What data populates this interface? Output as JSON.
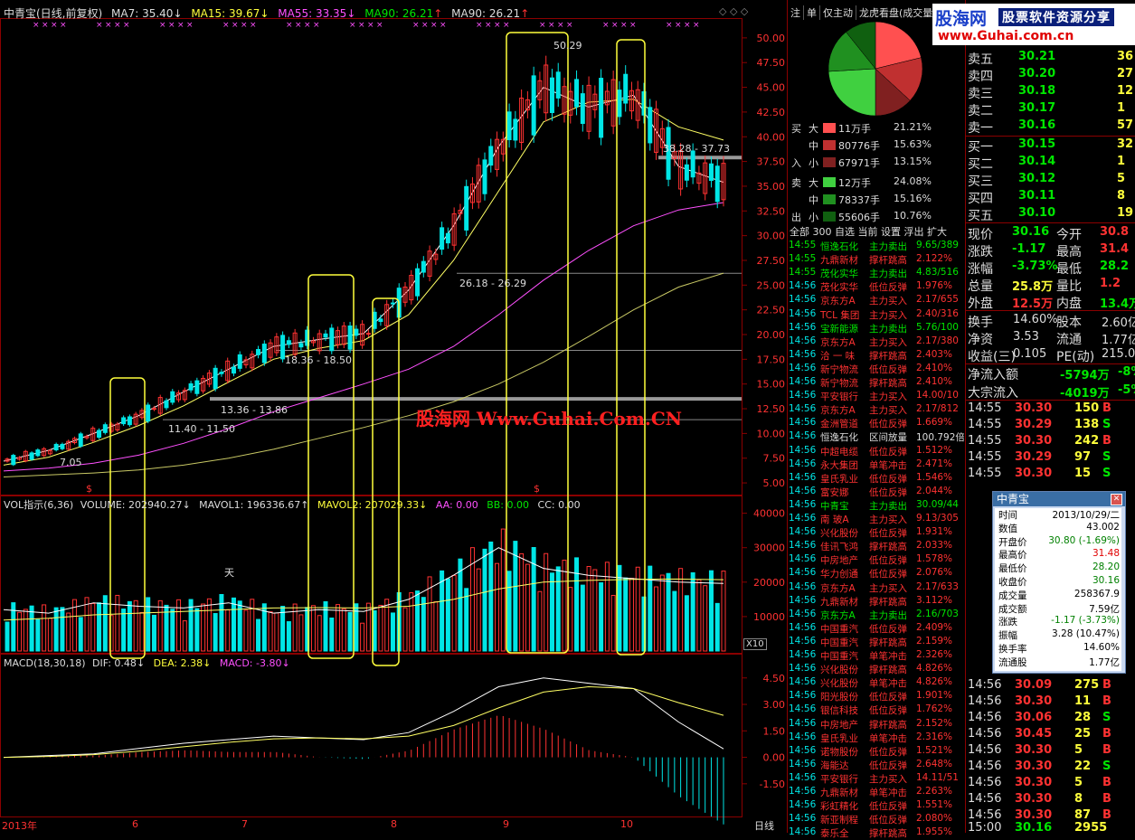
{
  "header": {
    "title": "中青宝(日线,前复权)",
    "ma7": "MA7: 35.40",
    "ma15": "MA15: 39.67",
    "ma55": "MA55: 33.35",
    "ma90a": "MA90: 26.21",
    "ma90b": "MA90: 26.21"
  },
  "vol_header": {
    "name": "VOL指示(6,36)",
    "volume": "VOLUME: 202940.27",
    "mavol1": "MAVOL1: 196336.67",
    "mavol2": "MAVOL2: 207029.33",
    "aa": "AA: 0.00",
    "bb": "BB: 0.00",
    "cc": "CC: 0.00"
  },
  "macd_header": {
    "name": "MACD(18,30,18)",
    "dif": "DIF: 0.48",
    "dea": "DEA: 2.38",
    "macd": "MACD: -3.80"
  },
  "bottom_axis": {
    "labels": [
      "2013年",
      "6",
      "7",
      "8",
      "9",
      "10"
    ],
    "period": "日线"
  },
  "x10_label": "X10",
  "chart_annotations": {
    "peak1": "50.29",
    "range1": "38.28 - 37.73",
    "range2": "26.18 - 26.29",
    "range3": "18.36 - 18.50",
    "range4": "13.36 - 13.86",
    "range5": "11.40 - 11.50",
    "low": "7.05",
    "tian": "天",
    "dollar": "$"
  },
  "watermark": "股海网 Www.Guhai.Com.CN",
  "chart_data": [
    {
      "type": "line",
      "title": "中青宝(日线,前复权)",
      "xlabel": "",
      "ylabel": "",
      "y_ticks": [
        5.0,
        7.5,
        10.0,
        12.5,
        15.0,
        17.5,
        20.0,
        22.5,
        25.0,
        27.5,
        30.0,
        32.5,
        35.0,
        37.5,
        40.0,
        42.5,
        45.0,
        47.5,
        50.0
      ],
      "ylim": [
        4.0,
        52.0
      ],
      "x_labels": [
        "2013年",
        "6",
        "7",
        "8",
        "9",
        "10"
      ],
      "series": [
        {
          "name": "MA7",
          "values": [
            7.2,
            8.3,
            10.0,
            11.8,
            14.2,
            16.5,
            18.8,
            19.5,
            20.1,
            24.5,
            31.0,
            39.0,
            45.0,
            43.0,
            44.2,
            37.0,
            35.4
          ]
        },
        {
          "name": "MA15",
          "values": [
            6.8,
            7.6,
            9.1,
            10.8,
            12.8,
            15.2,
            17.5,
            18.6,
            19.4,
            22.0,
            27.5,
            34.5,
            41.5,
            43.5,
            43.8,
            41.0,
            39.67
          ]
        },
        {
          "name": "MA55",
          "values": [
            6.2,
            6.5,
            7.0,
            7.8,
            9.0,
            10.5,
            12.2,
            13.6,
            15.0,
            16.5,
            18.8,
            22.0,
            25.5,
            28.5,
            31.0,
            32.6,
            33.35
          ]
        },
        {
          "name": "MA90",
          "values": [
            5.6,
            5.8,
            6.0,
            6.3,
            6.8,
            7.5,
            8.4,
            9.5,
            10.6,
            11.8,
            13.2,
            15.0,
            17.2,
            19.8,
            22.5,
            24.8,
            26.21
          ]
        }
      ]
    },
    {
      "type": "bar",
      "title": "VOL指示(6,36)",
      "y_ticks": [
        10000,
        20000,
        30000,
        40000
      ],
      "ylim": [
        0,
        42000
      ],
      "series": [
        {
          "name": "MAVOL1",
          "values": [
            12000,
            11000,
            14000,
            13000,
            12500,
            14000,
            11000,
            12000,
            11500,
            15000,
            22000,
            30000,
            24000,
            22000,
            21000,
            20000,
            19634
          ]
        },
        {
          "name": "MAVOL2",
          "values": [
            9000,
            9500,
            10500,
            11000,
            11500,
            12000,
            12500,
            12600,
            12500,
            13000,
            15000,
            18000,
            20000,
            20500,
            20800,
            20900,
            20703
          ]
        }
      ]
    },
    {
      "type": "line",
      "title": "MACD(18,30,18)",
      "y_ticks": [
        -1.5,
        0.0,
        1.5,
        3.0,
        4.5
      ],
      "ylim": [
        -3.2,
        5.0
      ],
      "series": [
        {
          "name": "DIF",
          "values": [
            0.0,
            0.1,
            0.2,
            0.5,
            0.8,
            1.0,
            1.2,
            1.1,
            1.0,
            1.4,
            2.6,
            4.0,
            4.5,
            4.2,
            3.9,
            2.0,
            0.48
          ]
        },
        {
          "name": "DEA",
          "values": [
            0.0,
            0.05,
            0.15,
            0.35,
            0.6,
            0.85,
            1.05,
            1.1,
            1.05,
            1.2,
            1.8,
            2.8,
            3.7,
            4.0,
            3.9,
            3.1,
            2.38
          ]
        }
      ]
    },
    {
      "type": "pie",
      "categories": [
        "买大",
        "买中",
        "买小",
        "卖大",
        "卖中",
        "卖小"
      ],
      "values": [
        21.21,
        15.63,
        13.15,
        24.08,
        15.16,
        10.76
      ]
    }
  ],
  "right_panel": {
    "tabs": [
      "注",
      "单",
      "仅主动",
      "龙虎看盘(成交量"
    ],
    "flow": [
      {
        "side": "买",
        "size": "大",
        "amount": "11万手",
        "pct": "21.21%",
        "color": "#ff5050"
      },
      {
        "side": "",
        "size": "中",
        "amount": "80776手",
        "pct": "15.63%",
        "color": "#c03030"
      },
      {
        "side": "入",
        "size": "小",
        "amount": "67971手",
        "pct": "13.15%",
        "color": "#802020"
      },
      {
        "side": "卖",
        "size": "大",
        "amount": "12万手",
        "pct": "24.08%",
        "color": "#40d040"
      },
      {
        "side": "",
        "size": "中",
        "amount": "78337手",
        "pct": "15.16%",
        "color": "#209020"
      },
      {
        "side": "出",
        "size": "小",
        "amount": "55606手",
        "pct": "10.76%",
        "color": "#106010"
      }
    ],
    "list_tabs": [
      "全部",
      "300",
      "自选",
      "当前",
      "设置",
      "浮出",
      "扩大"
    ],
    "alerts": [
      {
        "time": "14:55",
        "name": "恒逸石化",
        "type": "主力卖出",
        "val": "9.65/389",
        "c": "green"
      },
      {
        "time": "14:55",
        "name": "九鼎新材",
        "type": "撑杆跳高",
        "val": "2.122%",
        "c": "red"
      },
      {
        "time": "14:55",
        "name": "茂化实华",
        "type": "主力卖出",
        "val": "4.83/516",
        "c": "green"
      },
      {
        "time": "14:56",
        "name": "茂化实华",
        "type": "低位反弹",
        "val": "1.976%",
        "c": "red"
      },
      {
        "time": "14:56",
        "name": "京东方A",
        "type": "主力买入",
        "val": "2.17/655",
        "c": "red"
      },
      {
        "time": "14:56",
        "name": "TCL 集团",
        "type": "主力买入",
        "val": "2.40/316",
        "c": "red"
      },
      {
        "time": "14:56",
        "name": "宝新能源",
        "type": "主力卖出",
        "val": "5.76/100",
        "c": "green"
      },
      {
        "time": "14:56",
        "name": "京东方A",
        "type": "主力买入",
        "val": "2.17/380",
        "c": "red"
      },
      {
        "time": "14:56",
        "name": "洽 一 味",
        "type": "撑杆跳高",
        "val": "2.403%",
        "c": "red"
      },
      {
        "time": "14:56",
        "name": "新宁物流",
        "type": "低位反弹",
        "val": "2.410%",
        "c": "red"
      },
      {
        "time": "14:56",
        "name": "新宁物流",
        "type": "撑杆跳高",
        "val": "2.410%",
        "c": "red"
      },
      {
        "time": "14:56",
        "name": "平安银行",
        "type": "主力买入",
        "val": "14.00/10",
        "c": "red"
      },
      {
        "time": "14:56",
        "name": "京东方A",
        "type": "主力买入",
        "val": "2.17/812",
        "c": "red"
      },
      {
        "time": "14:56",
        "name": "金洲管道",
        "type": "低位反弹",
        "val": "1.669%",
        "c": "red"
      },
      {
        "time": "14:56",
        "name": "恒逸石化",
        "type": "区间放量",
        "val": "100.792倍",
        "c": "white"
      },
      {
        "time": "14:56",
        "name": "中超电缆",
        "type": "低位反弹",
        "val": "1.512%",
        "c": "red"
      },
      {
        "time": "14:56",
        "name": "永大集团",
        "type": "单笔冲击",
        "val": "2.471%",
        "c": "red"
      },
      {
        "time": "14:56",
        "name": "皇氏乳业",
        "type": "低位反弹",
        "val": "1.546%",
        "c": "red"
      },
      {
        "time": "14:56",
        "name": "富安娜",
        "type": "低位反弹",
        "val": "2.044%",
        "c": "red"
      },
      {
        "time": "14:56",
        "name": "中青宝",
        "type": "主力卖出",
        "val": "30.09/44",
        "c": "green"
      },
      {
        "time": "14:56",
        "name": "南 玻A",
        "type": "主力买入",
        "val": "9.13/305",
        "c": "red"
      },
      {
        "time": "14:56",
        "name": "兴化股份",
        "type": "低位反弹",
        "val": "1.931%",
        "c": "red"
      },
      {
        "time": "14:56",
        "name": "佳讯飞鸿",
        "type": "撑杆跳高",
        "val": "2.033%",
        "c": "red"
      },
      {
        "time": "14:56",
        "name": "中房地产",
        "type": "低位反弹",
        "val": "1.578%",
        "c": "red"
      },
      {
        "time": "14:56",
        "name": "华力创通",
        "type": "低位反弹",
        "val": "2.076%",
        "c": "red"
      },
      {
        "time": "14:56",
        "name": "京东方A",
        "type": "主力买入",
        "val": "2.17/633",
        "c": "red"
      },
      {
        "time": "14:56",
        "name": "九鼎新材",
        "type": "撑杆跳高",
        "val": "3.112%",
        "c": "red"
      },
      {
        "time": "14:56",
        "name": "京东方A",
        "type": "主力卖出",
        "val": "2.16/703",
        "c": "green"
      },
      {
        "time": "14:56",
        "name": "中国重汽",
        "type": "低位反弹",
        "val": "2.409%",
        "c": "red"
      },
      {
        "time": "14:56",
        "name": "中国重汽",
        "type": "撑杆跳高",
        "val": "2.159%",
        "c": "red"
      },
      {
        "time": "14:56",
        "name": "中国重汽",
        "type": "单笔冲击",
        "val": "2.326%",
        "c": "red"
      },
      {
        "time": "14:56",
        "name": "兴化股份",
        "type": "撑杆跳高",
        "val": "4.826%",
        "c": "red"
      },
      {
        "time": "14:56",
        "name": "兴化股份",
        "type": "单笔冲击",
        "val": "4.826%",
        "c": "red"
      },
      {
        "time": "14:56",
        "name": "阳光股份",
        "type": "低位反弹",
        "val": "1.901%",
        "c": "red"
      },
      {
        "time": "14:56",
        "name": "银信科技",
        "type": "低位反弹",
        "val": "1.762%",
        "c": "red"
      },
      {
        "time": "14:56",
        "name": "中房地产",
        "type": "撑杆跳高",
        "val": "2.152%",
        "c": "red"
      },
      {
        "time": "14:56",
        "name": "皇氏乳业",
        "type": "单笔冲击",
        "val": "2.316%",
        "c": "red"
      },
      {
        "time": "14:56",
        "name": "诺物股份",
        "type": "低位反弹",
        "val": "1.521%",
        "c": "red"
      },
      {
        "time": "14:56",
        "name": "海能达",
        "type": "低位反弹",
        "val": "2.648%",
        "c": "red"
      },
      {
        "time": "14:56",
        "name": "平安银行",
        "type": "主力买入",
        "val": "14.11/51",
        "c": "red"
      },
      {
        "time": "14:56",
        "name": "九鼎新材",
        "type": "单笔冲击",
        "val": "2.263%",
        "c": "red"
      },
      {
        "time": "14:56",
        "name": "彩虹精化",
        "type": "低位反弹",
        "val": "1.551%",
        "c": "red"
      },
      {
        "time": "14:56",
        "name": "新亚制程",
        "type": "低位反弹",
        "val": "2.080%",
        "c": "red"
      },
      {
        "time": "14:56",
        "name": "泰乐全",
        "type": "撑杆跳高",
        "val": "1.955%",
        "c": "red"
      }
    ]
  },
  "brand": {
    "name": "股海网",
    "slogan": "股票软件资源分享",
    "url": "www.Guhai.com.cn"
  },
  "order_book": {
    "sells": [
      {
        "label": "卖五",
        "price": "30.21",
        "vol": "36"
      },
      {
        "label": "卖四",
        "price": "30.20",
        "vol": "27"
      },
      {
        "label": "卖三",
        "price": "30.18",
        "vol": "12"
      },
      {
        "label": "卖二",
        "price": "30.17",
        "vol": "1"
      },
      {
        "label": "卖一",
        "price": "30.16",
        "vol": "57"
      }
    ],
    "buys": [
      {
        "label": "买一",
        "price": "30.15",
        "vol": "32"
      },
      {
        "label": "买二",
        "price": "30.14",
        "vol": "1"
      },
      {
        "label": "买三",
        "price": "30.12",
        "vol": "5"
      },
      {
        "label": "买四",
        "price": "30.11",
        "vol": "8"
      },
      {
        "label": "买五",
        "price": "30.10",
        "vol": "19"
      }
    ]
  },
  "quote": [
    {
      "k1": "现价",
      "v1": "30.16",
      "c1": "green",
      "k2": "今开",
      "v2": "30.8",
      "c2": "red"
    },
    {
      "k1": "涨跌",
      "v1": "-1.17",
      "c1": "green",
      "k2": "最高",
      "v2": "31.4",
      "c2": "red"
    },
    {
      "k1": "涨幅",
      "v1": "-3.73%",
      "c1": "green",
      "k2": "最低",
      "v2": "28.2",
      "c2": "green"
    },
    {
      "k1": "总量",
      "v1": "25.8万",
      "c1": "yellow",
      "k2": "量比",
      "v2": "1.2",
      "c2": "red"
    },
    {
      "k1": "外盘",
      "v1": "12.5万",
      "c1": "red",
      "k2": "内盘",
      "v2": "13.4万",
      "c2": "green"
    }
  ],
  "stats": [
    {
      "k1": "换手",
      "v1": "14.60%",
      "k2": "股本",
      "v2": "2.60亿"
    },
    {
      "k1": "净资",
      "v1": "3.53",
      "k2": "流通",
      "v2": "1.77亿"
    },
    {
      "k1": "收益(三)",
      "v1": "0.105",
      "k2": "PE(动)",
      "v2": "215.0"
    }
  ],
  "netflow": [
    {
      "k": "净流入额",
      "v": "-5794万",
      "p": "-8%"
    },
    {
      "k": "大宗流入",
      "v": "-4019万",
      "p": "-5%"
    }
  ],
  "ticks": [
    {
      "t": "14:55",
      "p": "30.30",
      "pc": "red",
      "v": "150",
      "s": "B"
    },
    {
      "t": "14:55",
      "p": "30.29",
      "pc": "red",
      "v": "138",
      "s": "S"
    },
    {
      "t": "14:55",
      "p": "30.30",
      "pc": "red",
      "v": "242",
      "s": "B"
    },
    {
      "t": "14:55",
      "p": "30.29",
      "pc": "red",
      "v": "97",
      "s": "S"
    },
    {
      "t": "14:55",
      "p": "30.30",
      "pc": "red",
      "v": "15",
      "s": "S"
    },
    {
      "t": "14:56",
      "p": "30.09",
      "pc": "red",
      "v": "275",
      "s": "B"
    },
    {
      "t": "14:56",
      "p": "30.30",
      "pc": "red",
      "v": "11",
      "s": "B"
    },
    {
      "t": "14:56",
      "p": "30.06",
      "pc": "red",
      "v": "28",
      "s": "S"
    },
    {
      "t": "14:56",
      "p": "30.45",
      "pc": "red",
      "v": "25",
      "s": "B"
    },
    {
      "t": "14:56",
      "p": "30.30",
      "pc": "red",
      "v": "5",
      "s": "B"
    },
    {
      "t": "14:56",
      "p": "30.30",
      "pc": "red",
      "v": "22",
      "s": "S"
    },
    {
      "t": "14:56",
      "p": "30.30",
      "pc": "red",
      "v": "5",
      "s": "B"
    },
    {
      "t": "14:56",
      "p": "30.30",
      "pc": "red",
      "v": "8",
      "s": "B"
    },
    {
      "t": "14:56",
      "p": "30.30",
      "pc": "red",
      "v": "87",
      "s": "B"
    },
    {
      "t": "15:00",
      "p": "30.16",
      "pc": "green",
      "v": "2955",
      "s": ""
    }
  ],
  "info_dialog": {
    "title": "中青宝",
    "rows": [
      {
        "k": "时间",
        "v": "2013/10/29/二",
        "c": "#000"
      },
      {
        "k": "数值",
        "v": "43.002",
        "c": "#000"
      },
      {
        "k": "开盘价",
        "v": "30.80 (-1.69%)",
        "c": "#008000"
      },
      {
        "k": "最高价",
        "v": "31.48",
        "c": "#e00000"
      },
      {
        "k": "最低价",
        "v": "28.20",
        "c": "#008000"
      },
      {
        "k": "收盘价",
        "v": "30.16",
        "c": "#008000"
      },
      {
        "k": "成交量",
        "v": "258367.9",
        "c": "#000"
      },
      {
        "k": "成交额",
        "v": "7.59亿",
        "c": "#000"
      },
      {
        "k": "涨跌",
        "v": "-1.17 (-3.73%)",
        "c": "#008000"
      },
      {
        "k": "振幅",
        "v": "3.28 (10.47%)",
        "c": "#000"
      },
      {
        "k": "换手率",
        "v": "14.60%",
        "c": "#000"
      },
      {
        "k": "流通股",
        "v": "1.77亿",
        "c": "#000"
      }
    ]
  },
  "colors": {
    "up": "#ff3232",
    "down": "#00e6e6",
    "ma7": "#ffffff",
    "ma15": "#ffff64",
    "ma55": "#ff50ff",
    "ma90": "#c8c864",
    "highlight": "#ffff3c"
  }
}
